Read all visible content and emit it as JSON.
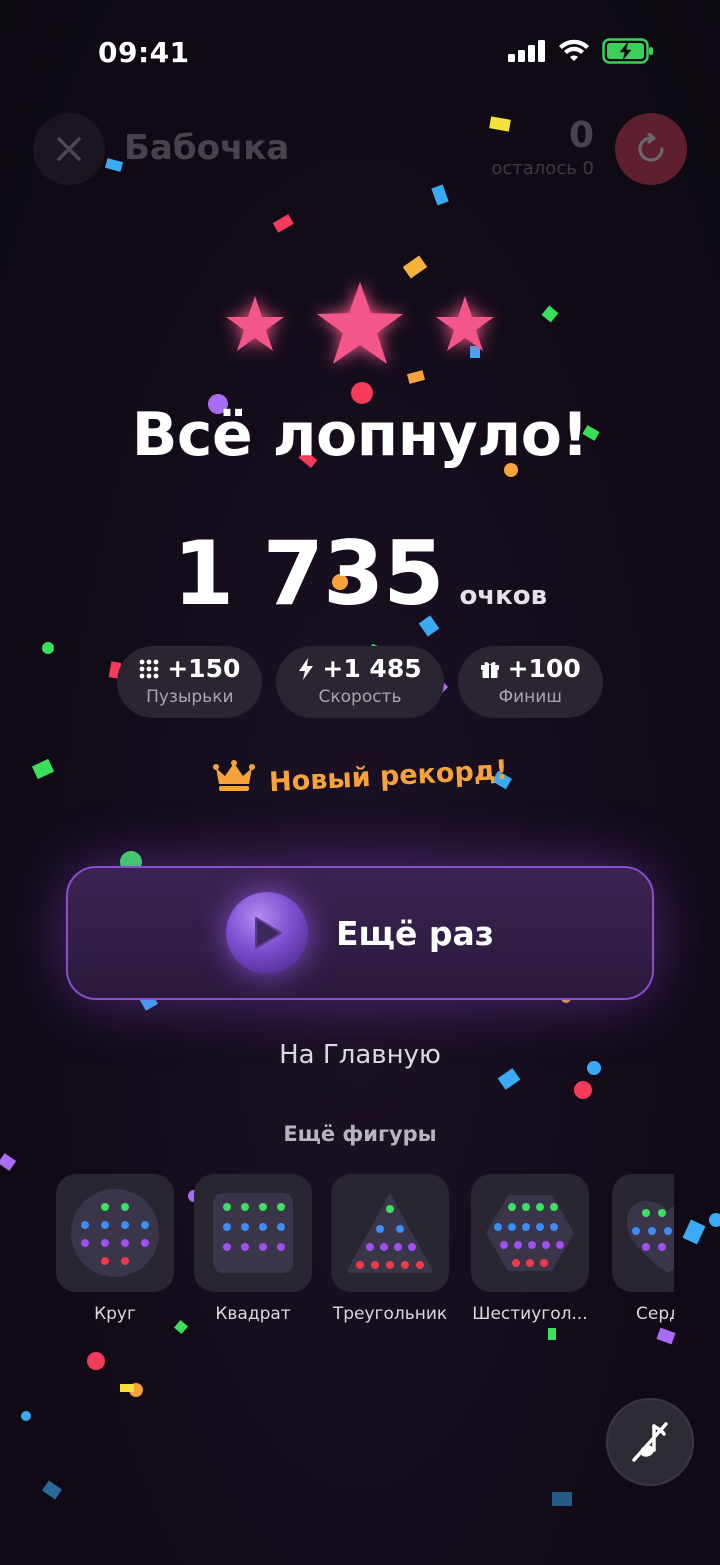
{
  "status_bar": {
    "time": "09:41"
  },
  "header": {
    "title": "Бабочка",
    "counter_value": "0",
    "counter_label": "осталось 0"
  },
  "result": {
    "stars_earned": 3,
    "stars_total": 3,
    "headline": "Всё лопнуло!",
    "score": "1 735",
    "score_unit": "очков"
  },
  "bonuses": [
    {
      "icon": "dots-grid-icon",
      "value": "+150",
      "label": "Пузырьки"
    },
    {
      "icon": "lightning-icon",
      "value": "+1 485",
      "label": "Скорость"
    },
    {
      "icon": "gift-icon",
      "value": "+100",
      "label": "Финиш"
    }
  ],
  "record": {
    "icon": "crown-icon",
    "text": "Новый рекорд!"
  },
  "actions": {
    "play_again": "Ещё раз",
    "home": "На Главную"
  },
  "more_shapes": {
    "title": "Ещё фигуры",
    "items": [
      {
        "label": "Круг"
      },
      {
        "label": "Квадрат"
      },
      {
        "label": "Треугольник"
      },
      {
        "label": "Шестиугол..."
      },
      {
        "label": "Серд"
      }
    ]
  },
  "colors": {
    "accent_pink": "#f2578a",
    "accent_orange": "#f5a33a",
    "accent_purple": "#8a4fd0",
    "restart_red": "#e0425a"
  }
}
